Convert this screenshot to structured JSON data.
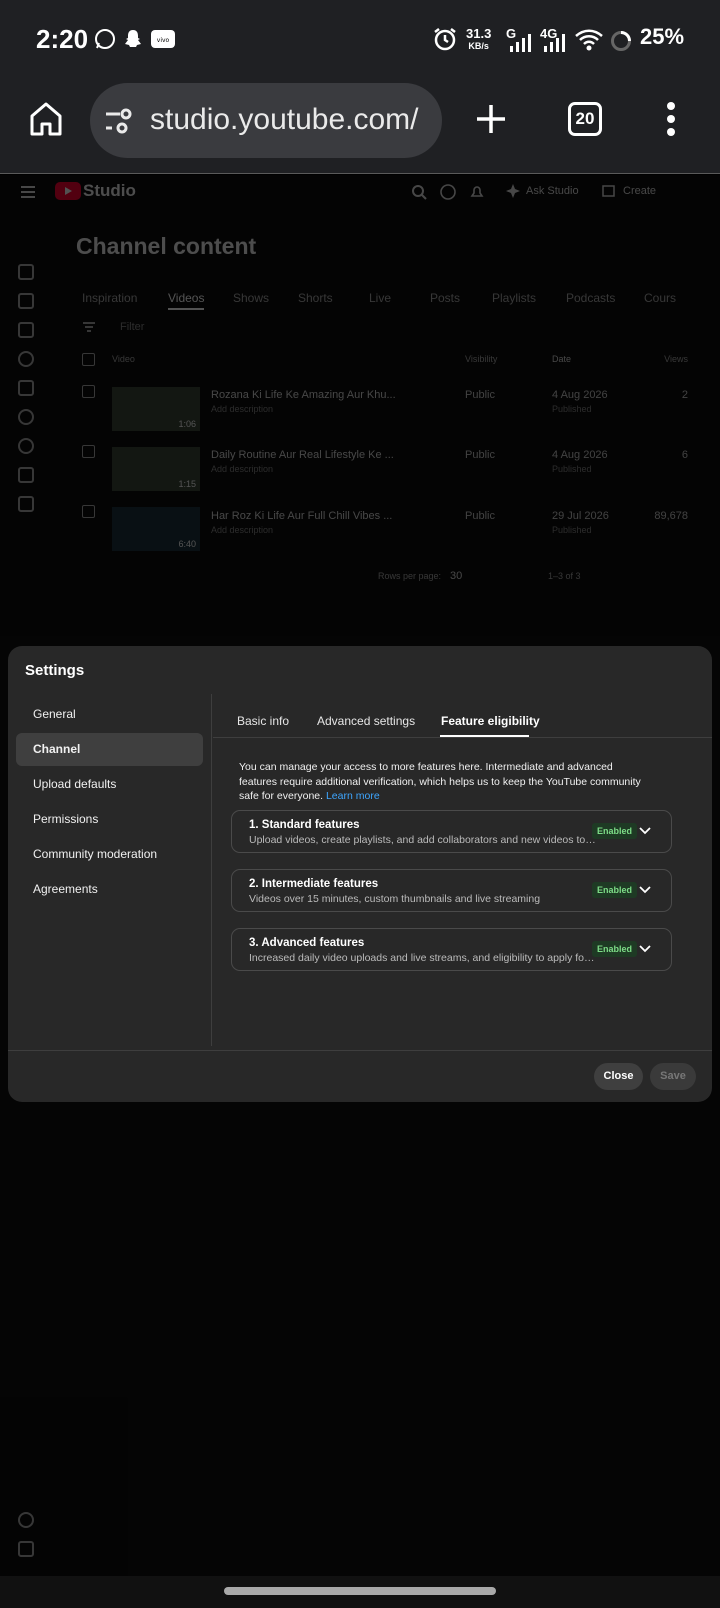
{
  "status_bar": {
    "time": "2:20",
    "net_speed_value": "31.3",
    "net_speed_unit": "KB/s",
    "network_1": "G",
    "network_2": "4G",
    "battery": "25%"
  },
  "browser": {
    "url": "studio.youtube.com/",
    "tab_count": "20"
  },
  "studio": {
    "logo_text": "Studio",
    "ask_studio": "Ask Studio",
    "create": "Create",
    "page_title": "Channel content",
    "tabs": [
      "Inspiration",
      "Videos",
      "Shows",
      "Shorts",
      "Live",
      "Posts",
      "Playlists",
      "Podcasts",
      "Cours"
    ],
    "filter_placeholder": "Filter",
    "columns": {
      "video": "Video",
      "visibility": "Visibility",
      "date": "Date",
      "views": "Views"
    },
    "rows": [
      {
        "title": "Rozana Ki Life Ke Amazing Aur Khu...",
        "desc": "Add description",
        "duration": "1:06",
        "visibility": "Public",
        "date": "4 Aug 2026",
        "status": "Published",
        "views": "2"
      },
      {
        "title": "Daily Routine Aur Real Lifestyle Ke ...",
        "desc": "Add description",
        "duration": "1:15",
        "visibility": "Public",
        "date": "4 Aug 2026",
        "status": "Published",
        "views": "6"
      },
      {
        "title": "Har Roz Ki Life Aur Full Chill Vibes ...",
        "desc": "Add description",
        "duration": "6:40",
        "visibility": "Public",
        "date": "29 Jul 2026",
        "status": "Published",
        "views": "89,678"
      }
    ],
    "rows_per_page_label": "Rows per page:",
    "rows_per_page": "30",
    "range": "1–3 of 3"
  },
  "settings": {
    "title": "Settings",
    "nav": [
      "General",
      "Channel",
      "Upload defaults",
      "Permissions",
      "Community moderation",
      "Agreements"
    ],
    "tabs": [
      "Basic info",
      "Advanced settings",
      "Feature eligibility"
    ],
    "intro": "You can manage your access to more features here. Intermediate and advanced features require additional verification, which helps us to keep the YouTube community safe for everyone.",
    "learn_more": "Learn more",
    "features": [
      {
        "title": "1. Standard features",
        "desc": "Upload videos, create playlists, and add collaborators and new videos to playlists",
        "status": "Enabled"
      },
      {
        "title": "2. Intermediate features",
        "desc": "Videos over 15 minutes, custom thumbnails and live streaming",
        "status": "Enabled"
      },
      {
        "title": "3. Advanced features",
        "desc": "Increased daily video uploads and live streams, and eligibility to apply for monetization",
        "status": "Enabled"
      }
    ],
    "close": "Close",
    "save": "Save"
  }
}
